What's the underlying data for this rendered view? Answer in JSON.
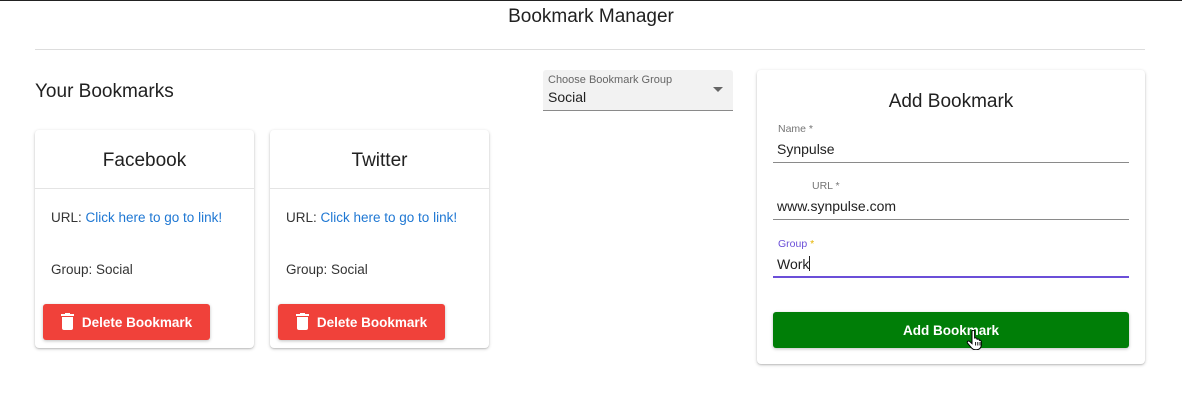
{
  "app": {
    "title": "Bookmark Manager"
  },
  "list": {
    "heading": "Your Bookmarks",
    "group_select": {
      "label": "Choose Bookmark Group",
      "value": "Social"
    },
    "bookmarks": [
      {
        "title": "Facebook",
        "url_prefix": "URL: ",
        "link_text": "Click here to go to link!",
        "group_text": "Group: Social",
        "delete_label": "Delete Bookmark"
      },
      {
        "title": "Twitter",
        "url_prefix": "URL: ",
        "link_text": "Click here to go to link!",
        "group_text": "Group: Social",
        "delete_label": "Delete Bookmark"
      }
    ]
  },
  "form": {
    "title": "Add Bookmark",
    "name": {
      "label": "Name",
      "value": "Synpulse"
    },
    "url": {
      "label": "URL",
      "value": "www.synpulse.com"
    },
    "group": {
      "label": "Group",
      "value": "Work"
    },
    "required_mark": " *",
    "submit_label": "Add Bookmark"
  },
  "colors": {
    "danger": "#f0413a",
    "success": "#007e07",
    "link": "#1e77d3",
    "focus": "#6b4fd8"
  },
  "icons": {
    "delete": "trash-icon",
    "dropdown": "chevron-down-icon",
    "cursor": "hand-pointer-icon"
  }
}
